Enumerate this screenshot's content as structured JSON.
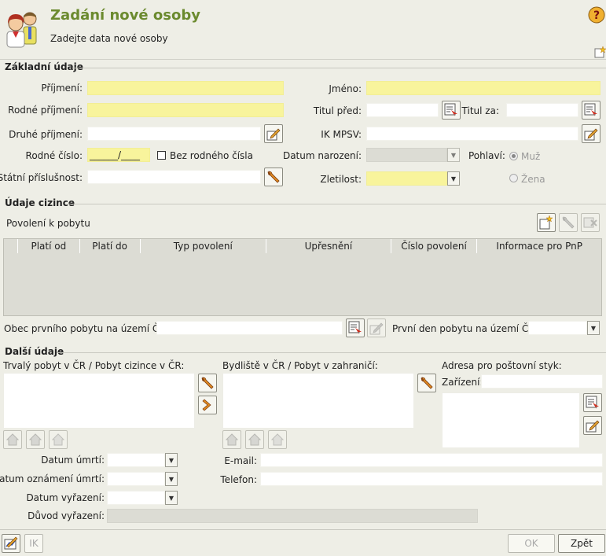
{
  "header": {
    "title": "Zadání nové osoby",
    "subtitle": "Zadejte data nové osoby"
  },
  "basic": {
    "section_title": "Základní údaje",
    "prijmeni_label": "Příjmení:",
    "jmeno_label": "Jméno:",
    "rodne_prijmeni_label": "Rodné příjmení:",
    "titul_pred_label": "Titul před:",
    "titul_za_label": "Titul za:",
    "druhe_prijmeni_label": "Druhé příjmení:",
    "ik_mpsv_label": "IK MPSV:",
    "rodne_cislo_label": "Rodné číslo:",
    "rodne_cislo_mask": "______/____",
    "bez_rc_label": "Bez rodného čísla",
    "datum_narozeni_label": "Datum narození:",
    "pohlavi_label": "Pohlaví:",
    "muz_label": "Muž",
    "zena_label": "Žena",
    "statni_prislusnost_label": "Státní příslušnost:",
    "zletilost_label": "Zletilost:"
  },
  "foreign": {
    "section_title": "Údaje cizince",
    "povoleni_label": "Povolení k pobytu",
    "columns": [
      "Platí od",
      "Platí do",
      "Typ povolení",
      "Upřesnění",
      "Číslo povolení",
      "Informace pro PnP"
    ],
    "obec_label": "Obec prvního pobytu na území ČR:",
    "prvni_den_label": "První den pobytu na území ČR:"
  },
  "other": {
    "section_title": "Další údaje",
    "trvaly_pobyt_label": "Trvalý pobyt v ČR / Pobyt cizince v ČR:",
    "bydliste_label": "Bydliště v ČR / Pobyt v zahraničí:",
    "adresa_label": "Adresa pro poštovní styk:",
    "zarizeni_label": "Zařízení:",
    "datum_umrti_label": "Datum úmrtí:",
    "datum_oznameni_label": "Datum oznámení úmrtí:",
    "datum_vyrazeni_label": "Datum vyřazení:",
    "duvod_vyrazeni_label": "Důvod vyřazení:",
    "email_label": "E-mail:",
    "telefon_label": "Telefon:"
  },
  "footer": {
    "ik_label": "IK",
    "ok_label": "OK",
    "back_label": "Zpět"
  },
  "colors": {
    "required_field": "#f8f49c",
    "title_green": "#6b8a2e",
    "background": "#eeeee6"
  },
  "icons": {
    "header": "persons-icon",
    "help": "help-icon",
    "new_record": "new-record-icon",
    "pick": "pick-list-icon",
    "edit": "pencil-edit-icon",
    "tools": "wrench-icon",
    "next": "chevron-right-icon",
    "house": "house-icon"
  }
}
